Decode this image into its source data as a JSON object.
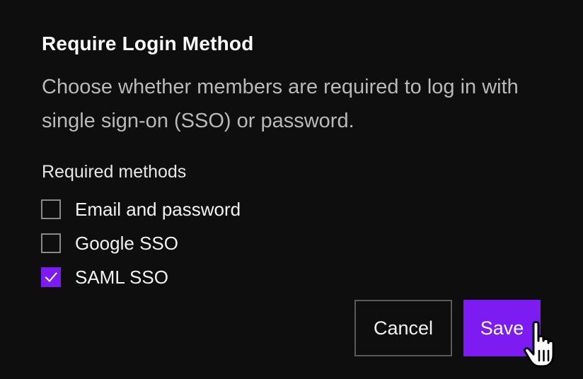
{
  "dialog": {
    "title": "Require Login Method",
    "description": "Choose whether members are required to log in with single sign-on (SSO) or password.",
    "section_label": "Required methods",
    "options": [
      {
        "label": "Email and password",
        "checked": false
      },
      {
        "label": "Google SSO",
        "checked": false
      },
      {
        "label": "SAML SSO",
        "checked": true
      }
    ],
    "buttons": {
      "cancel_label": "Cancel",
      "save_label": "Save"
    }
  },
  "colors": {
    "background": "#0e0e0e",
    "accent": "#7c1cf3",
    "text_primary": "#ffffff",
    "text_secondary": "#b9b9b9",
    "border": "#5a5a5a"
  },
  "icons": {
    "check": "check-icon",
    "pointer": "hand-pointer-cursor-icon"
  }
}
